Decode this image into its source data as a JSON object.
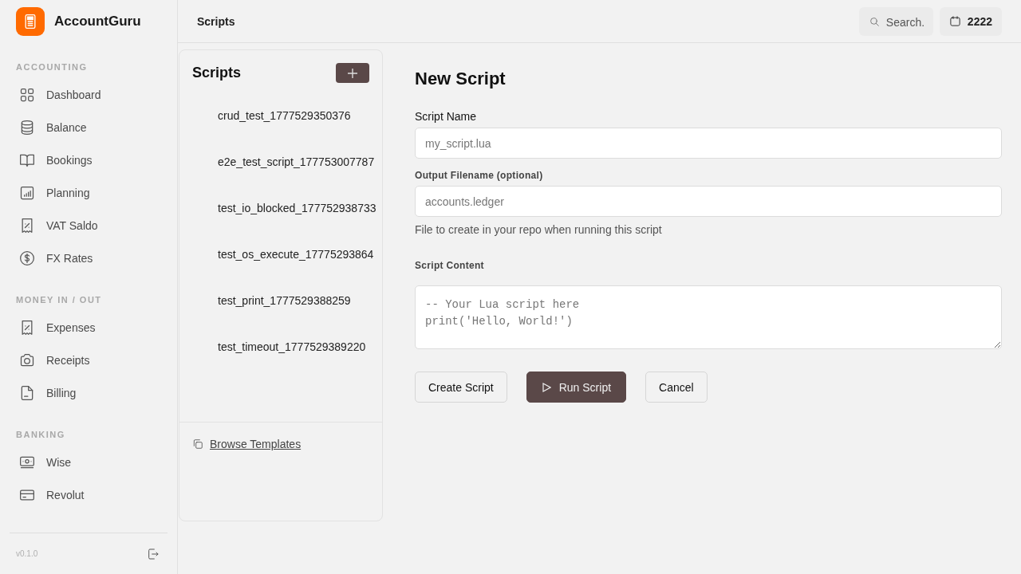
{
  "app": {
    "name": "AccountGuru",
    "version": "v0.1.0"
  },
  "sidebar": {
    "sections": [
      {
        "title": "ACCOUNTING",
        "items": [
          {
            "label": "Dashboard"
          },
          {
            "label": "Balance"
          },
          {
            "label": "Bookings"
          },
          {
            "label": "Planning"
          },
          {
            "label": "VAT Saldo"
          },
          {
            "label": "FX Rates"
          }
        ]
      },
      {
        "title": "MONEY IN / OUT",
        "items": [
          {
            "label": "Expenses"
          },
          {
            "label": "Receipts"
          },
          {
            "label": "Billing"
          }
        ]
      },
      {
        "title": "BANKING",
        "items": [
          {
            "label": "Wise"
          },
          {
            "label": "Revolut"
          }
        ]
      }
    ]
  },
  "topbar": {
    "title": "Scripts",
    "search": {
      "placeholder": "Search."
    },
    "year": "2222"
  },
  "scripts_panel": {
    "title": "Scripts",
    "items": [
      {
        "name": "crud_test_1777529350376"
      },
      {
        "name": "e2e_test_script_177753007787"
      },
      {
        "name": "test_io_blocked_177752938733"
      },
      {
        "name": "test_os_execute_17775293864"
      },
      {
        "name": "test_print_1777529388259"
      },
      {
        "name": "test_timeout_1777529389220"
      }
    ],
    "footer_link": "Browse Templates"
  },
  "form": {
    "title": "New Script",
    "fields": [
      {
        "kind": "input",
        "label": "Script Name",
        "placeholder": "my_script.lua"
      },
      {
        "kind": "input",
        "label": "Output Filename (optional)",
        "placeholder": "accounts.ledger",
        "help": "File to create in your repo when running this script"
      },
      {
        "kind": "textarea",
        "label": "Script Content",
        "placeholder": "-- Your Lua script here\nprint('Hello, World!')"
      }
    ],
    "buttons": [
      {
        "label": "Create Script",
        "kind": "secondary"
      },
      {
        "label": "Run Script",
        "kind": "primary"
      },
      {
        "label": "Cancel",
        "kind": "secondary"
      }
    ]
  }
}
